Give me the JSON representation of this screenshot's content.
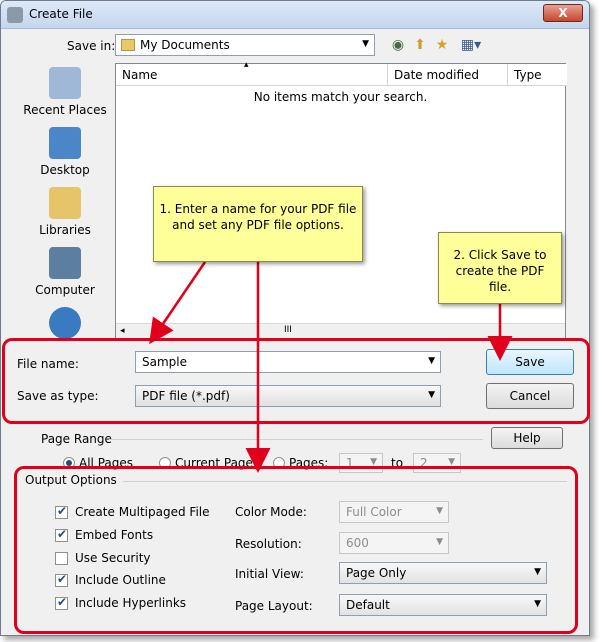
{
  "window": {
    "title": "Create File",
    "close_label": "X"
  },
  "save_in": {
    "label": "Save in:",
    "value": "My Documents"
  },
  "places": [
    {
      "label": "Recent Places",
      "icon": "recent-places-icon"
    },
    {
      "label": "Desktop",
      "icon": "desktop-icon"
    },
    {
      "label": "Libraries",
      "icon": "libraries-icon"
    },
    {
      "label": "Computer",
      "icon": "computer-icon"
    },
    {
      "label": "",
      "icon": "network-icon"
    }
  ],
  "file_list": {
    "columns": [
      "Name",
      "Date modified",
      "Type"
    ],
    "empty_message": "No items match your search.",
    "scroll_grip": "III"
  },
  "file_name": {
    "label": "File name:",
    "value": "Sample"
  },
  "save_as_type": {
    "label": "Save as type:",
    "value": "PDF file (*.pdf)"
  },
  "buttons": {
    "save": "Save",
    "cancel": "Cancel",
    "help": "Help"
  },
  "page_range": {
    "title": "Page Range",
    "all_pages": "All Pages",
    "current_page": "Current Page",
    "pages": "Pages:",
    "from": "1",
    "to_label": "to",
    "to": "2"
  },
  "output_options": {
    "title": "Output Options",
    "checkboxes": [
      {
        "label": "Create Multipaged File",
        "checked": true
      },
      {
        "label": "Embed Fonts",
        "checked": true
      },
      {
        "label": "Use Security",
        "checked": false
      },
      {
        "label": "Include Outline",
        "checked": true
      },
      {
        "label": "Include Hyperlinks",
        "checked": true
      }
    ],
    "color_mode": {
      "label": "Color Mode:",
      "value": "Full Color"
    },
    "resolution": {
      "label": "Resolution:",
      "value": "600"
    },
    "initial_view": {
      "label": "Initial View:",
      "value": "Page Only"
    },
    "page_layout": {
      "label": "Page Layout:",
      "value": "Default"
    }
  },
  "callouts": {
    "step1": "1. Enter a name for your PDF file and set any PDF file options.",
    "step2": "2. Click Save to create the PDF file."
  },
  "colors": {
    "highlight": "#e1001b",
    "callout_bg": "#ffff99"
  }
}
